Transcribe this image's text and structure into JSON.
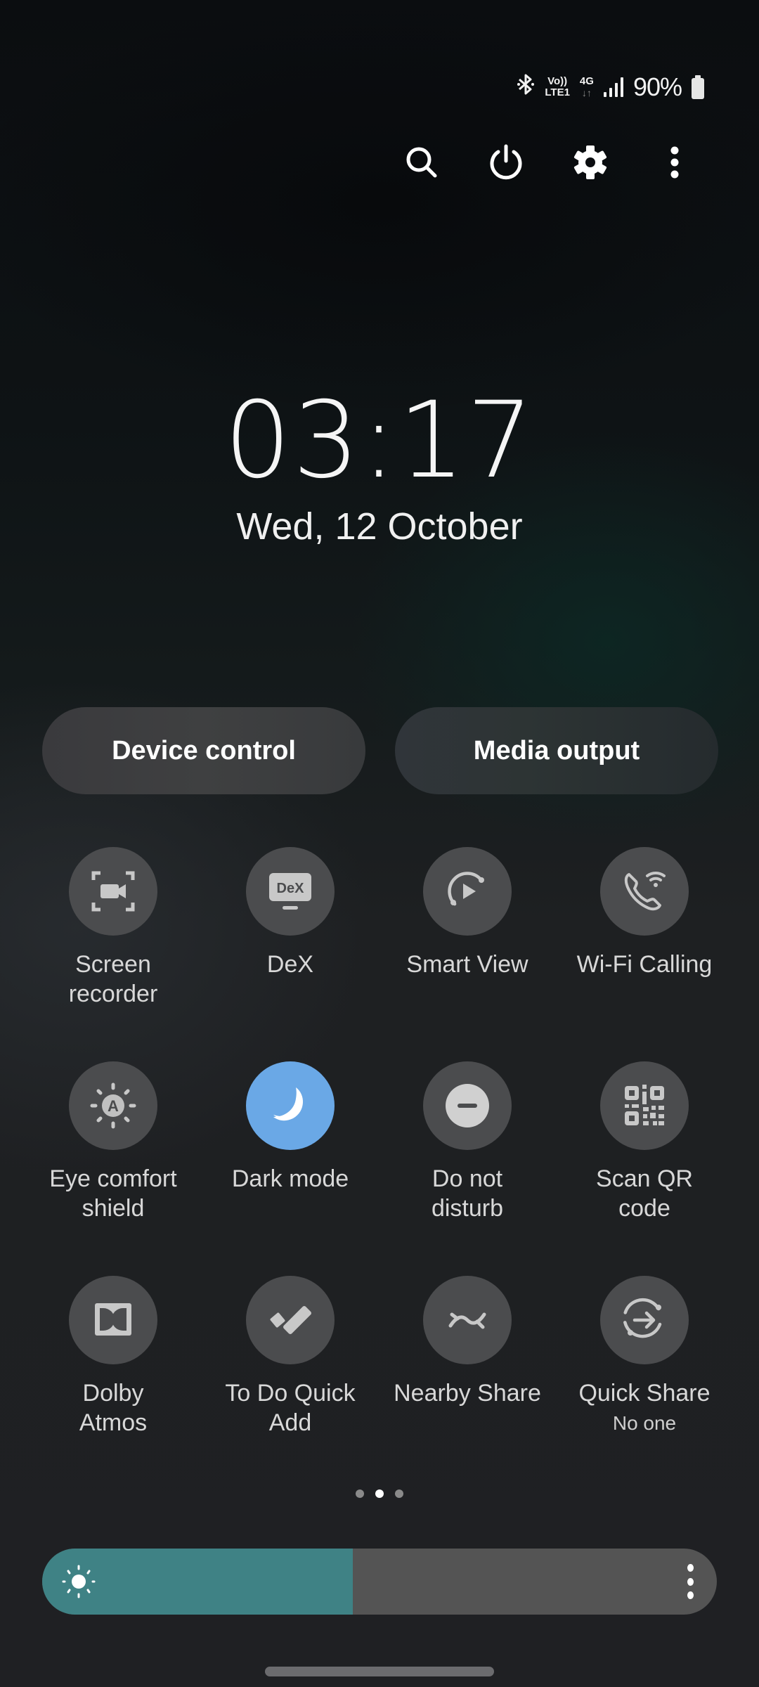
{
  "status_bar": {
    "bluetooth_icon": "bluetooth-icon",
    "volte_top": "Vo))",
    "volte_bottom": "LTE1",
    "network_type": "4G",
    "network_arrows": "↓↑",
    "signal_bars": 4,
    "battery_percent": "90%"
  },
  "top_actions": [
    {
      "name": "search",
      "icon": "search-icon"
    },
    {
      "name": "power",
      "icon": "power-icon"
    },
    {
      "name": "settings",
      "icon": "gear-icon"
    },
    {
      "name": "more-options",
      "icon": "more-vertical-icon"
    }
  ],
  "clock": {
    "time": "03:17",
    "date": "Wed, 12 October"
  },
  "buttons": {
    "device_control": "Device control",
    "media_output": "Media output"
  },
  "tiles": [
    {
      "label": "Screen\nrecorder",
      "icon": "screen-recorder-icon",
      "active": false
    },
    {
      "label": "DeX",
      "icon": "dex-icon",
      "icon_text": "DeX",
      "active": false
    },
    {
      "label": "Smart View",
      "icon": "smart-view-icon",
      "active": false
    },
    {
      "label": "Wi-Fi Calling",
      "icon": "wifi-calling-icon",
      "active": false
    },
    {
      "label": "Eye comfort\nshield",
      "icon": "eye-comfort-icon",
      "icon_text": "A",
      "active": false
    },
    {
      "label": "Dark mode",
      "icon": "moon-icon",
      "active": true
    },
    {
      "label": "Do not\ndisturb",
      "icon": "do-not-disturb-icon",
      "active": false
    },
    {
      "label": "Scan QR\ncode",
      "icon": "qr-code-icon",
      "active": false
    },
    {
      "label": "Dolby\nAtmos",
      "icon": "dolby-icon",
      "active": false
    },
    {
      "label": "To Do Quick\nAdd",
      "icon": "todo-check-icon",
      "active": false
    },
    {
      "label": "Nearby Share",
      "icon": "nearby-share-icon",
      "active": false
    },
    {
      "label": "Quick Share",
      "sublabel": "No one",
      "icon": "quick-share-icon",
      "active": false
    }
  ],
  "pagination": {
    "total": 3,
    "current": 2
  },
  "brightness": {
    "level_percent": 46
  },
  "colors": {
    "active_tile": "#6aa8e6",
    "inactive_tile": "#4b4c4e",
    "brightness_fill": "#3f8285",
    "brightness_track": "#545454"
  }
}
